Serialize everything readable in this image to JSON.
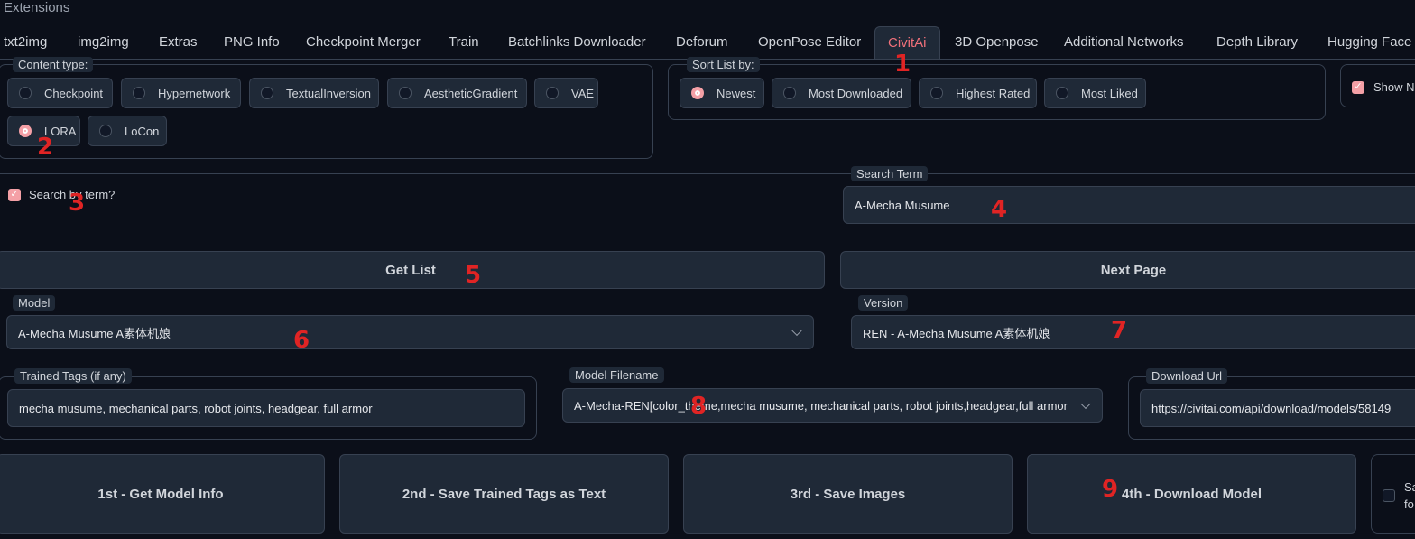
{
  "header": {
    "title": "Extensions"
  },
  "tabs": [
    {
      "label": "txt2img"
    },
    {
      "label": "img2img"
    },
    {
      "label": "Extras"
    },
    {
      "label": "PNG Info"
    },
    {
      "label": "Checkpoint Merger"
    },
    {
      "label": "Train"
    },
    {
      "label": "Batchlinks Downloader"
    },
    {
      "label": "Deforum"
    },
    {
      "label": "OpenPose Editor"
    },
    {
      "label": "CivitAi"
    },
    {
      "label": "3D Openpose"
    },
    {
      "label": "Additional Networks"
    },
    {
      "label": "Depth Library"
    },
    {
      "label": "Hugging Face"
    }
  ],
  "active_tab": "CivitAi",
  "content_type": {
    "legend": "Content type:",
    "options": [
      "Checkpoint",
      "Hypernetwork",
      "TextualInversion",
      "AestheticGradient",
      "VAE",
      "LORA",
      "LoCon"
    ],
    "selected": "LORA"
  },
  "sort": {
    "legend": "Sort List by:",
    "options": [
      "Newest",
      "Most Downloaded",
      "Highest Rated",
      "Most Liked"
    ],
    "selected": "Newest"
  },
  "show_nsfw": {
    "label": "Show N",
    "checked": true
  },
  "search_by_term": {
    "label": "Search by term?",
    "checked": true
  },
  "search_term": {
    "label": "Search Term",
    "value": "A-Mecha Musume"
  },
  "buttons": {
    "get_list": "Get List",
    "next_page": "Next Page"
  },
  "model": {
    "label": "Model",
    "value": "A-Mecha Musume A素体机娘"
  },
  "version": {
    "label": "Version",
    "value": "REN - A-Mecha Musume A素体机娘"
  },
  "trained_tags": {
    "label": "Trained Tags (if any)",
    "value": "mecha musume, mechanical parts, robot joints, headgear, full armor"
  },
  "model_filename": {
    "label": "Model Filename",
    "value": "A-Mecha-REN[color_theme,mecha musume, mechanical parts, robot joints,headgear,full armor"
  },
  "download_url": {
    "label": "Download Url",
    "value": "https://civitai.com/api/download/models/58149"
  },
  "actions": {
    "get_info": "1st - Get Model Info",
    "save_tags": "2nd - Save Trained Tags as Text",
    "save_images": "3rd - Save Images",
    "download": "4th - Download Model"
  },
  "save_folder": {
    "label_line1": "Sa",
    "label_line2": "fo",
    "checked": false
  },
  "markers": [
    "1",
    "2",
    "3",
    "4",
    "5",
    "6",
    "7",
    "8",
    "9"
  ],
  "colors": {
    "accent": "#f0707a",
    "marker": "#e02424",
    "bg": "#0b0f19",
    "panel": "#1f2937",
    "border": "#374151"
  }
}
